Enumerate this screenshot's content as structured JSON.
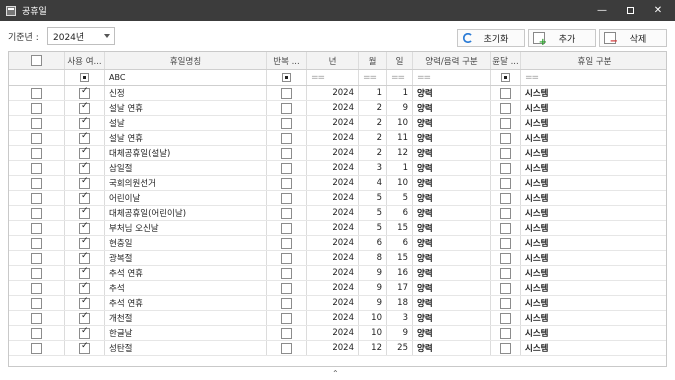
{
  "window": {
    "title": "공휴일",
    "icon": "calendar-window-icon"
  },
  "toolbar": {
    "year_label": "기준년 :",
    "year_value": "2024년",
    "reset_label": "초기화",
    "add_label": "추가",
    "delete_label": "삭제"
  },
  "grid": {
    "headers": [
      "",
      "사용 여...",
      "휴일명칭",
      "반복 ...",
      "년",
      "월",
      "일",
      "양력/음력 구분",
      "윤달 ...",
      "휴일 구분"
    ],
    "filter": {
      "text_op": "ABC",
      "num_op": "=="
    },
    "rows": [
      {
        "use": true,
        "name": "신정",
        "repeat": false,
        "year": "2024",
        "month": "1",
        "day": "1",
        "cal": "양력",
        "leap": false,
        "type": "시스템"
      },
      {
        "use": true,
        "name": "설날 연휴",
        "repeat": false,
        "year": "2024",
        "month": "2",
        "day": "9",
        "cal": "양력",
        "leap": false,
        "type": "시스템"
      },
      {
        "use": true,
        "name": "설날",
        "repeat": false,
        "year": "2024",
        "month": "2",
        "day": "10",
        "cal": "양력",
        "leap": false,
        "type": "시스템"
      },
      {
        "use": true,
        "name": "설날 연휴",
        "repeat": false,
        "year": "2024",
        "month": "2",
        "day": "11",
        "cal": "양력",
        "leap": false,
        "type": "시스템"
      },
      {
        "use": true,
        "name": "대체공휴일(설날)",
        "repeat": false,
        "year": "2024",
        "month": "2",
        "day": "12",
        "cal": "양력",
        "leap": false,
        "type": "시스템"
      },
      {
        "use": true,
        "name": "삼일절",
        "repeat": false,
        "year": "2024",
        "month": "3",
        "day": "1",
        "cal": "양력",
        "leap": false,
        "type": "시스템"
      },
      {
        "use": true,
        "name": "국회의원선거",
        "repeat": false,
        "year": "2024",
        "month": "4",
        "day": "10",
        "cal": "양력",
        "leap": false,
        "type": "시스템"
      },
      {
        "use": true,
        "name": "어린이날",
        "repeat": false,
        "year": "2024",
        "month": "5",
        "day": "5",
        "cal": "양력",
        "leap": false,
        "type": "시스템"
      },
      {
        "use": true,
        "name": "대체공휴일(어린이날)",
        "repeat": false,
        "year": "2024",
        "month": "5",
        "day": "6",
        "cal": "양력",
        "leap": false,
        "type": "시스템"
      },
      {
        "use": true,
        "name": "부처님 오신날",
        "repeat": false,
        "year": "2024",
        "month": "5",
        "day": "15",
        "cal": "양력",
        "leap": false,
        "type": "시스템"
      },
      {
        "use": true,
        "name": "현충일",
        "repeat": false,
        "year": "2024",
        "month": "6",
        "day": "6",
        "cal": "양력",
        "leap": false,
        "type": "시스템"
      },
      {
        "use": true,
        "name": "광복절",
        "repeat": false,
        "year": "2024",
        "month": "8",
        "day": "15",
        "cal": "양력",
        "leap": false,
        "type": "시스템"
      },
      {
        "use": true,
        "name": "추석 연휴",
        "repeat": false,
        "year": "2024",
        "month": "9",
        "day": "16",
        "cal": "양력",
        "leap": false,
        "type": "시스템"
      },
      {
        "use": true,
        "name": "추석",
        "repeat": false,
        "year": "2024",
        "month": "9",
        "day": "17",
        "cal": "양력",
        "leap": false,
        "type": "시스템"
      },
      {
        "use": true,
        "name": "추석 연휴",
        "repeat": false,
        "year": "2024",
        "month": "9",
        "day": "18",
        "cal": "양력",
        "leap": false,
        "type": "시스템"
      },
      {
        "use": true,
        "name": "개천절",
        "repeat": false,
        "year": "2024",
        "month": "10",
        "day": "3",
        "cal": "양력",
        "leap": false,
        "type": "시스템"
      },
      {
        "use": true,
        "name": "한글날",
        "repeat": false,
        "year": "2024",
        "month": "10",
        "day": "9",
        "cal": "양력",
        "leap": false,
        "type": "시스템"
      },
      {
        "use": true,
        "name": "성탄절",
        "repeat": false,
        "year": "2024",
        "month": "12",
        "day": "25",
        "cal": "양력",
        "leap": false,
        "type": "시스템"
      }
    ]
  }
}
